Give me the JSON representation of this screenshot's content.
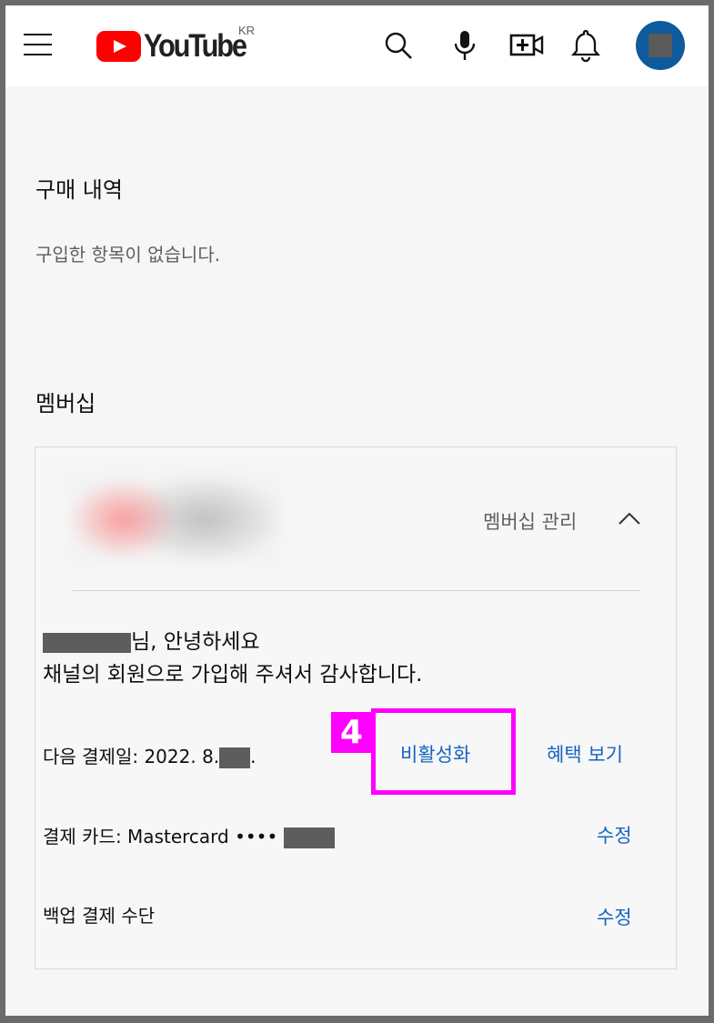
{
  "header": {
    "logo_text": "YouTube",
    "country_code": "KR",
    "icons": [
      "menu-icon",
      "search-icon",
      "microphone-icon",
      "create-video-icon",
      "notifications-bell-icon",
      "avatar"
    ]
  },
  "purchases": {
    "title": "구매 내역",
    "empty_text": "구입한 항목이 없습니다."
  },
  "membership": {
    "title": "멤버십",
    "manage_label": "멤버십 관리",
    "greeting_suffix": "님, 안녕하세요",
    "thanks_text": "채널의 회원으로 가입해 주셔서 감사합니다.",
    "next_billing_label": "다음 결제일: 2022. 8.",
    "next_billing_tail": ".",
    "deactivate_label": "비활성화",
    "benefits_label": "혜택 보기",
    "payment_card_label": "결제 카드: Mastercard ••••",
    "edit_card_label": "수정",
    "backup_payment_label": "백업 결제 수단",
    "edit_backup_label": "수정"
  },
  "annotation": {
    "step_number": "4",
    "highlight_color": "#ff00ff"
  },
  "colors": {
    "link_blue": "#1565c0",
    "youtube_red": "#ff0000",
    "avatar_blue": "#0d5a9c"
  }
}
